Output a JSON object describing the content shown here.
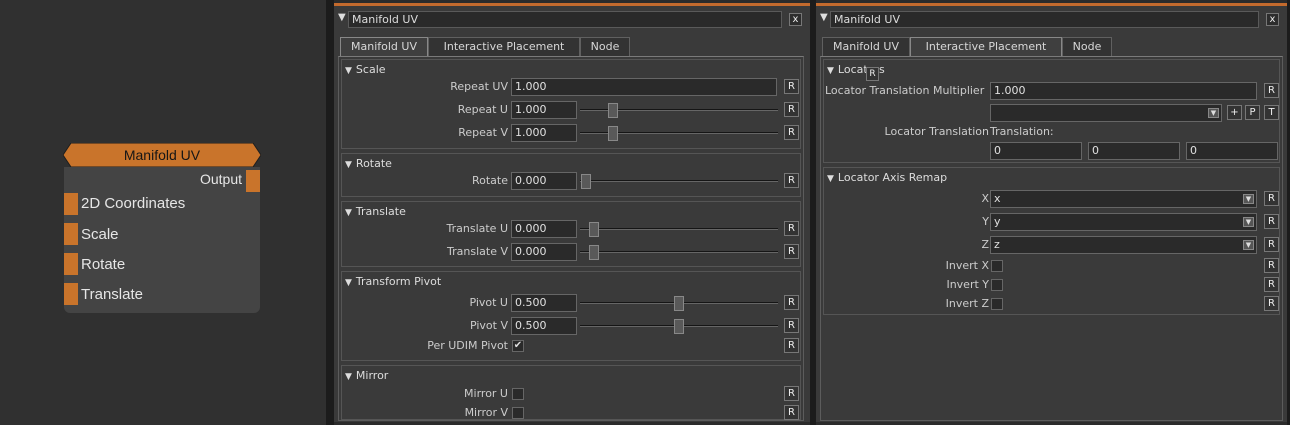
{
  "node": {
    "title": "Manifold UV",
    "output_label": "Output",
    "inputs": [
      "2D Coordinates",
      "Scale",
      "Rotate",
      "Translate"
    ],
    "header_color": "#c9742b"
  },
  "panel_left": {
    "title": "Manifold UV",
    "close": "x",
    "tabs": [
      "Manifold UV",
      "Interactive Placement",
      "Node"
    ],
    "active_tab": 0,
    "groups": {
      "scale": {
        "title": "Scale",
        "repeat_uv_label": "Repeat UV",
        "repeat_uv": "1.000",
        "repeat_u_label": "Repeat U",
        "repeat_u": "1.000",
        "repeat_v_label": "Repeat V",
        "repeat_v": "1.000"
      },
      "rotate": {
        "title": "Rotate",
        "rotate_label": "Rotate",
        "rotate": "0.000"
      },
      "translate": {
        "title": "Translate",
        "translate_u_label": "Translate U",
        "translate_u": "0.000",
        "translate_v_label": "Translate V",
        "translate_v": "0.000"
      },
      "pivot": {
        "title": "Transform Pivot",
        "pivot_u_label": "Pivot U",
        "pivot_u": "0.500",
        "pivot_v_label": "Pivot V",
        "pivot_v": "0.500",
        "per_udim_label": "Per UDIM Pivot",
        "per_udim_check": "✔"
      },
      "mirror": {
        "title": "Mirror",
        "mirror_u_label": "Mirror U",
        "mirror_v_label": "Mirror V"
      }
    },
    "reset": "R"
  },
  "panel_right": {
    "title": "Manifold UV",
    "close": "x",
    "tabs": [
      "Manifold UV",
      "Interactive Placement",
      "Node"
    ],
    "active_tab": 1,
    "locators": {
      "title": "Locators",
      "r_badge": "R",
      "multiplier_label": "Locator Translation Multiplier",
      "multiplier": "1.000",
      "plus": "+",
      "p": "P",
      "t": "T",
      "translation_label": "Locator Translation",
      "translation_caption": "Translation:",
      "tx": "0",
      "ty": "0",
      "tz": "0"
    },
    "remap": {
      "title": "Locator Axis Remap",
      "x_label": "X",
      "x_value": "x",
      "y_label": "Y",
      "y_value": "y",
      "z_label": "Z",
      "z_value": "z",
      "invert_x": "Invert X",
      "invert_y": "Invert Y",
      "invert_z": "Invert Z"
    },
    "reset": "R"
  }
}
